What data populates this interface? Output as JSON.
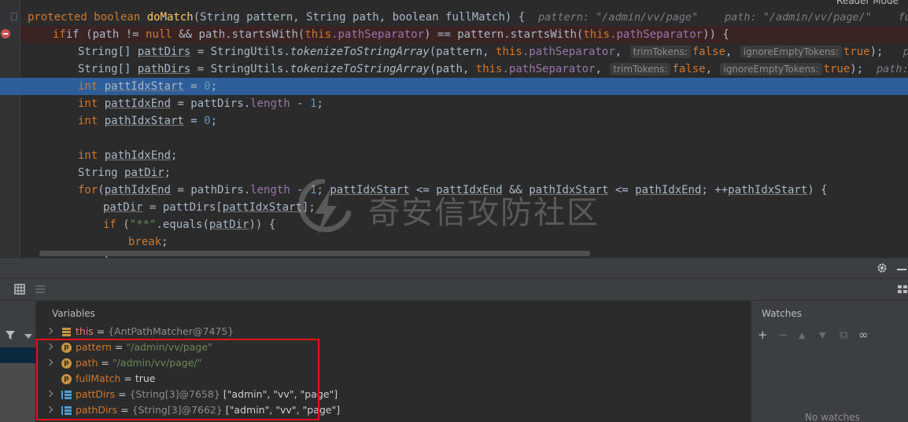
{
  "editor": {
    "reader_mode": "Reader Mode",
    "watermark": "奇安信攻防社区",
    "line1": {
      "prefix": "protected boolean ",
      "method": "doMatch",
      "params": "(String pattern, String path, boolean fullMatch) {",
      "hint_pattern": "pattern: \"/admin/vv/page\"",
      "hint_path": "path: \"/admin/vv/page/\"",
      "hint_full": "fullMat"
    },
    "line2": {
      "a": "if (path != ",
      "null": "null",
      "b": " && path.startsWith(",
      "this1": "this",
      "f1": ".pathSeparator",
      "c": ") == pattern.startsWith(",
      "this2": "this",
      "f2": ".pathSeparator",
      "d": ")) {"
    },
    "line3": {
      "a": "String[] ",
      "v": "pattDirs",
      "b": " = StringUtils.",
      "m": "tokenizeToStringArray",
      "c": "(pattern, ",
      "th": "this",
      "f": ".pathSeparator",
      "d": ", ",
      "h1": "trimTokens:",
      "k1": "false",
      "e": ", ",
      "h2": "ignoreEmptyTokens:",
      "k2": "true",
      "g": ");",
      "tail": "pattern"
    },
    "line4": {
      "a": "String[] ",
      "v": "pathDirs",
      "b": " = StringUtils.",
      "m": "tokenizeToStringArray",
      "c": "(path, ",
      "th": "this",
      "f": ".pathSeparator",
      "d": ", ",
      "h1": "trimTokens:",
      "k1": "false",
      "e": ", ",
      "h2": "ignoreEmptyTokens:",
      "k2": "true",
      "g": ");",
      "tail": "path: \"/ad"
    },
    "line5": {
      "kw": "int ",
      "v": "pattIdxStart",
      "b": " = ",
      "n": "0",
      "e": ";"
    },
    "line6": {
      "kw": "int ",
      "v": "pattIdxEnd",
      "b": " = pattDirs.",
      "f": "length",
      "c": " - ",
      "n": "1",
      "e": ";"
    },
    "line7": {
      "kw": "int ",
      "v": "pathIdxStart",
      "b": " = ",
      "n": "0",
      "e": ";"
    },
    "line9": {
      "kw": "int ",
      "v": "pathIdxEnd",
      "e": ";"
    },
    "line10": {
      "a": "String ",
      "v": "patDir",
      "e": ";"
    },
    "line11": {
      "kw": "for",
      "a": "(",
      "v1": "pathIdxEnd",
      "b": " = pathDirs.",
      "f": "length",
      "c": " - ",
      "n": "1",
      "d": "; ",
      "v2": "pattIdxStart",
      "e": " <= ",
      "v3": "pattIdxEnd",
      "g": " && ",
      "v4": "pathIdxStart",
      "h": " <= ",
      "v5": "pathIdxEnd",
      "i": "; ++",
      "v6": "pathIdxStart",
      "j": ") {"
    },
    "line12": {
      "v1": "patDir",
      "a": " = pattDirs[",
      "v2": "pattIdxStart",
      "b": "];"
    },
    "line13": {
      "kw": "if",
      "a": " (",
      "s": "\"**\"",
      "b": ".equals(",
      "v": "patDir",
      "c": ")) {"
    },
    "line14": {
      "kw": "break",
      "e": ";"
    },
    "line15": {
      "a": "}"
    }
  },
  "debugger": {
    "variables_title": "Variables",
    "watches_title": "Watches",
    "no_watches": "No watches",
    "variables": [
      {
        "name": "this",
        "eq": " = ",
        "obj": "{AntPathMatcher@7475}",
        "value": "",
        "str": ""
      },
      {
        "name": "pattern",
        "eq": " = ",
        "obj": "",
        "value": "",
        "str": "\"/admin/vv/page\""
      },
      {
        "name": "path",
        "eq": " = ",
        "obj": "",
        "value": "",
        "str": "\"/admin/vv/page/\""
      },
      {
        "name": "fullMatch",
        "eq": " = ",
        "obj": "",
        "value": "true",
        "str": ""
      },
      {
        "name": "pattDirs",
        "eq": " = ",
        "obj": "{String[3]@7658}",
        "value": " [\"admin\", \"vv\", \"page\"]",
        "str": ""
      },
      {
        "name": "pathDirs",
        "eq": " = ",
        "obj": "{String[3]@7662}",
        "value": " [\"admin\", \"vv\", \"page\"]",
        "str": ""
      }
    ],
    "param_badge": "p",
    "watch_tools": {
      "add": "+",
      "remove": "−",
      "up": "▲",
      "down": "▼",
      "copy": "⧉",
      "glasses": "∞"
    }
  },
  "colors": {
    "highlight_box": "#e3111b",
    "exec_line": "#2d5e99",
    "keyword": "#cc7832"
  }
}
